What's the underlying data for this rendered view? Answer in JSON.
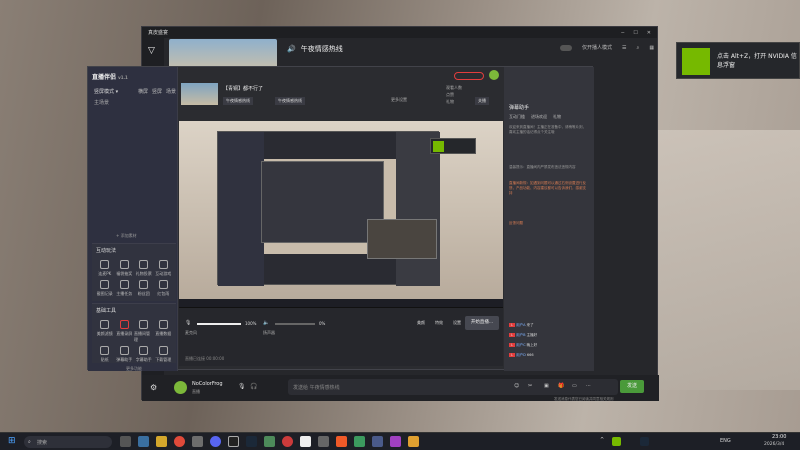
{
  "window_main": {
    "title": "真皮盛宴",
    "channel_title": "午夜情感热线",
    "mode_toggle_label": "仅开播人模式",
    "chat_placeholder": "发送给 午夜情感热线",
    "send_button": "发送",
    "user": {
      "name": "NoColorFrog",
      "sub": "直播"
    },
    "footer_note": "发送消息代表您已阅读并同意相关规则"
  },
  "window_studio": {
    "logo": "直播伴侣",
    "version": "v1.1",
    "left": {
      "scene_mode": "竖屏模式",
      "tabs": [
        "横屏",
        "竖屏",
        "场景"
      ],
      "scene_item": "主场景",
      "add_scene": "+ 添加素材",
      "interaction_header": "互动玩法",
      "interaction_items": [
        "连麦PK",
        "福袋抽奖",
        "礼物投票",
        "互动游戏",
        "截图记录",
        "主播任务",
        "粉丝团",
        "红包雨"
      ],
      "tools_header": "基础工具",
      "tools_items": [
        "美颜滤镜",
        "直播录屏",
        "直播间管理",
        "直播数据",
        "贴纸",
        "弹幕助手",
        "字幕助手",
        "下载管理"
      ],
      "more": "更多功能"
    },
    "top": {
      "stream_title": "【青铜】都不行了",
      "tags": [
        "午夜情感热线",
        "午夜情感热线"
      ],
      "sub_right": "更多设置",
      "stats": [
        "观看人数",
        "点赞",
        "礼物"
      ],
      "action": "关播"
    },
    "bottom": {
      "mic_label": "麦克风",
      "mic_pct": "100%",
      "speaker_label": "扬声器",
      "speaker_pct": "0%",
      "buttons": [
        "美颜",
        "特效",
        "设置"
      ],
      "start_button": "开始直播...",
      "status": "直播已连接 00:00:00"
    },
    "right": {
      "header": "弹幕助手",
      "tabs": [
        "互动门槛",
        "进场欢迎",
        "礼物"
      ],
      "msg1": "欢迎来到直播间！主播正在准备中，请稍等片刻，喜欢主播的话记得点个关注哦",
      "msg2": "温馨提示：直播间内严禁发布违法违规内容",
      "msg3": "直播间新规：如遇到问题可以通过右侧设置进行反馈，产品功能、内容建议都可以告诉我们，感谢支持",
      "msg4": "反馈问题",
      "chat_names": [
        "用户A",
        "用户B",
        "用户C",
        "用户D"
      ],
      "chat_texts": [
        "来了",
        "主播好",
        "晚上好",
        "666"
      ]
    }
  },
  "nvidia": {
    "text": "点击 Alt+Z，打开 NVIDIA 信息浮窗"
  },
  "taskbar": {
    "search_placeholder": "搜索",
    "lang": "ENG",
    "time": "23:00",
    "date": "2026/3/4"
  },
  "colors": {
    "nvidia_green": "#76b900",
    "accent_red": "#e23d3d",
    "start_button": "#464851"
  }
}
